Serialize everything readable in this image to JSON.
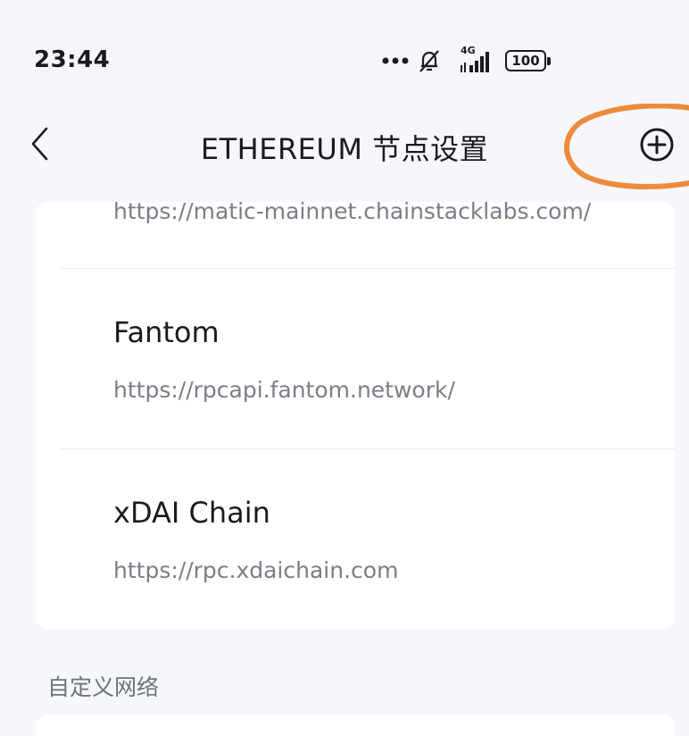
{
  "status_bar": {
    "time": "23:44",
    "network_label": "4G",
    "battery_level": "100"
  },
  "header": {
    "title": "ETHEREUM 节点设置",
    "back_icon": "chevron-left-icon",
    "add_icon": "plus-circle-icon"
  },
  "nodes": [
    {
      "name": "",
      "url": "https://matic-mainnet.chainstacklabs.com/"
    },
    {
      "name": "Fantom",
      "url": "https://rpcapi.fantom.network/"
    },
    {
      "name": "xDAI Chain",
      "url": "https://rpc.xdaichain.com"
    }
  ],
  "sections": {
    "custom_network_title": "自定义网络"
  },
  "colors": {
    "background": "#f6f7fb",
    "card": "#ffffff",
    "primary_text": "#1b1b1f",
    "secondary_text": "#7b7e87",
    "highlight": "#ee8a3c"
  }
}
